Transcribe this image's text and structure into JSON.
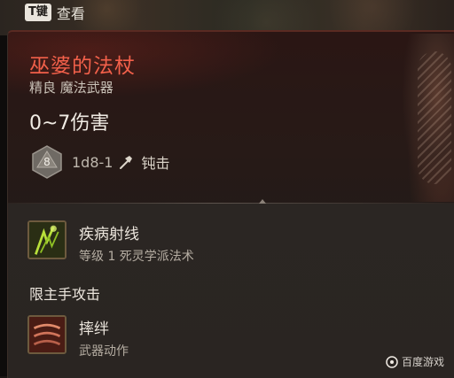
{
  "hint": {
    "key": "T键",
    "label": "查看"
  },
  "item": {
    "name": "巫婆的法杖",
    "type": "精良 魔法武器",
    "damage": "0~7伤害",
    "die_label": "8",
    "dice_formula": "1d8-1",
    "damage_type": "钝击"
  },
  "abilities": [
    {
      "title": "疾病射线",
      "subtitle": "等级 1 死灵学派法术",
      "icon": "disease-ray-icon"
    },
    {
      "title": "摔绊",
      "subtitle": "武器动作",
      "icon": "topple-icon"
    }
  ],
  "section_label": "限主手攻击",
  "watermark": "百度游戏",
  "colors": {
    "item_name": "#f2604a",
    "border": "#5a2a22"
  }
}
